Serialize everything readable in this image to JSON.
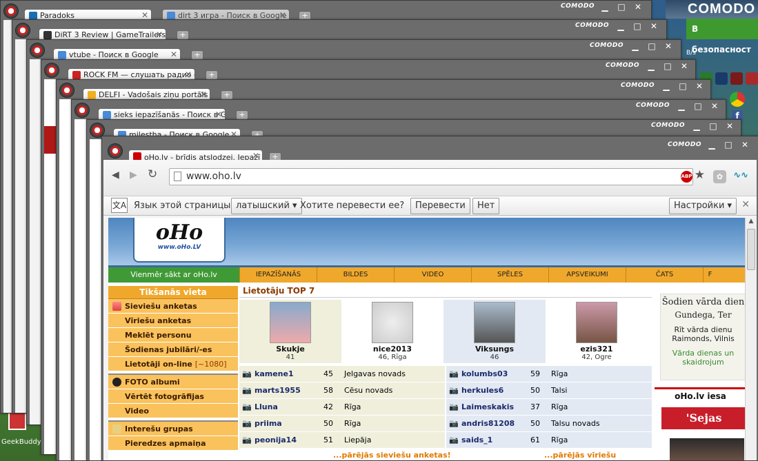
{
  "desktop": {
    "ad_title": "COMODO",
    "ad_subtitle": "В безопасност",
    "speed": "B/s",
    "geekbuddy_label": "GeekBuddy"
  },
  "windows": [
    {
      "tab1": "Paradoks",
      "tab2": "dirt 3 игра - Поиск в Google",
      "brand": "COMODO"
    },
    {
      "tab1": "DiRT 3 Review | GameTrailers",
      "brand": "COMODO"
    },
    {
      "tab1": "vtube - Поиск в Google",
      "brand": "COMODO"
    },
    {
      "tab1": "ROCK FM — слушать радио он",
      "brand": "COMODO"
    },
    {
      "tab1": "DELFI - Vadošais ziņu portāls L",
      "brand": "COMODO"
    },
    {
      "tab1": "sieks iepazīšanās - Поиск в Goo",
      "brand": "COMODO"
    },
    {
      "tab1": "milestha - Поиск в Google",
      "brand": "COMODO"
    }
  ],
  "main": {
    "brand": "COMODO",
    "tab_title": "oHo.lv - brīdis atslodzei. Iepazī",
    "url": "www.oho.lv",
    "abp": "ABP",
    "translate": {
      "prompt": "Язык этой страницы",
      "language": "латышский ▾",
      "question": "Хотите перевести ее?",
      "translate_btn": "Перевести",
      "no_btn": "Нет",
      "settings_btn": "Настройки ▾"
    }
  },
  "site": {
    "logo_big": "oHo",
    "logo_small": "www.oHo.LV",
    "nav_green": "Vienmēr sākt ar oHo.lv",
    "nav": [
      "IEPAZĪŠANĀS",
      "BILDES",
      "VIDEO",
      "SPĒLES",
      "APSVEIKUMI",
      "ČATS",
      "F"
    ],
    "side_title": "Tikšanās vieta",
    "side_group1": [
      "Sieviešu anketas",
      "Vīriešu anketas",
      "Meklēt personu",
      "Šodienas jubilāri/-es",
      "Lietotāji on-line"
    ],
    "online_count": "[~1080]",
    "side_group2": [
      "FOTO albumi",
      "Vērtēt fotogrāfijas",
      "Video"
    ],
    "side_group3": [
      "Interešu grupas",
      "Pieredzes apmaiņa"
    ],
    "top7_title": "Lietotāju TOP 7",
    "top_users": [
      {
        "name": "Skukje",
        "info": "41"
      },
      {
        "name": "nice2013",
        "info": "46, Rīga"
      },
      {
        "name": "Viksungs",
        "info": "46"
      },
      {
        "name": "ezis321",
        "info": "42, Ogre"
      }
    ],
    "women": [
      {
        "name": "kamene1",
        "age": "45",
        "city": "Jelgavas novads"
      },
      {
        "name": "marts1955",
        "age": "58",
        "city": "Cēsu novads"
      },
      {
        "name": "Lluna",
        "age": "42",
        "city": "Rīga"
      },
      {
        "name": "priima",
        "age": "50",
        "city": "Rīga"
      },
      {
        "name": "peonija14",
        "age": "51",
        "city": "Liepāja"
      }
    ],
    "men": [
      {
        "name": "kolumbs03",
        "age": "59",
        "city": "Rīga"
      },
      {
        "name": "herkules6",
        "age": "50",
        "city": "Talsi"
      },
      {
        "name": "Laimeskakis",
        "age": "37",
        "city": "Rīga"
      },
      {
        "name": "andris81208",
        "age": "50",
        "city": "Talsu novads"
      },
      {
        "name": "saids_1",
        "age": "61",
        "city": "Rīga"
      }
    ],
    "more_women": "...pārējās sieviešu anketas!",
    "more_men": "...pārējās vīriešu anketas!",
    "nameday_title": "Šodien vārda dien",
    "nameday_names": "Gundega, Ter",
    "tomorrow_title": "Rīt vārda dienu",
    "tomorrow_names": "Raimonds, Vilnis",
    "nameday_link": "Vārda dienas un skaidrojum",
    "oho_label": "oHo.lv iesa",
    "sejas": "'Sejas"
  }
}
